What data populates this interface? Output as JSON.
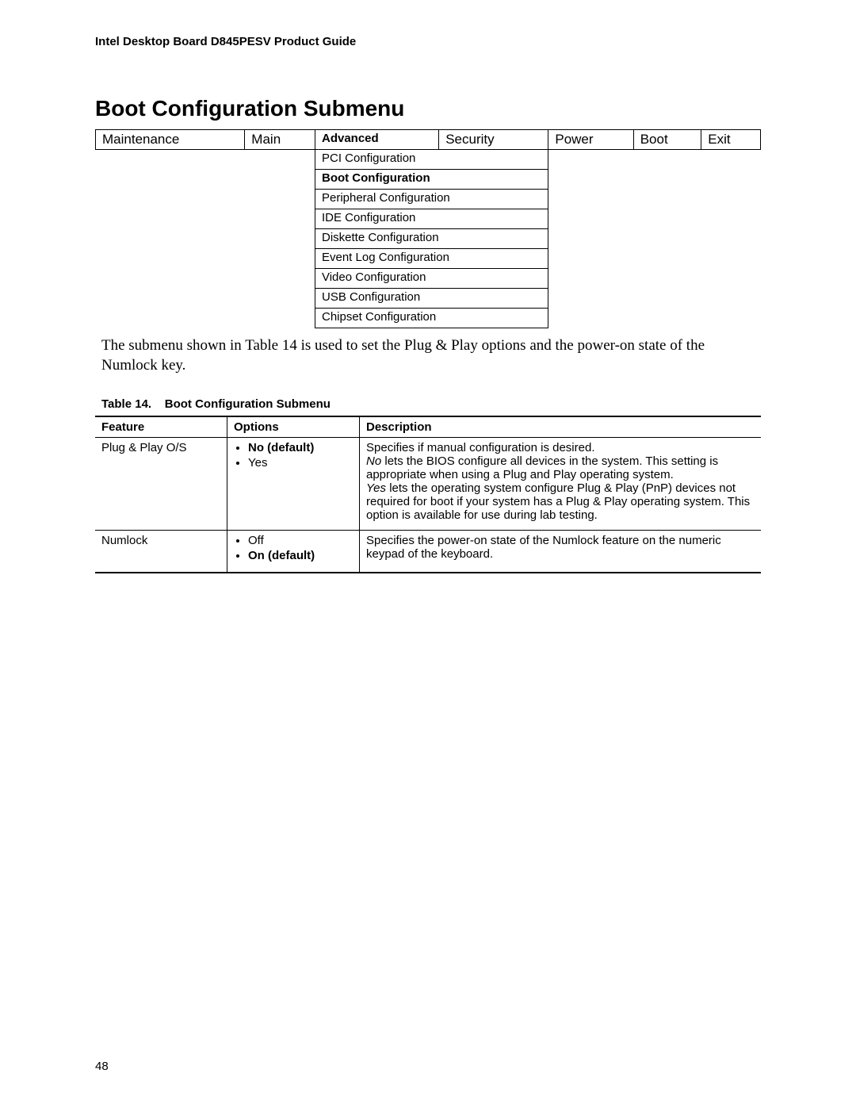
{
  "doc_header": "Intel Desktop Board D845PESV Product Guide",
  "section_title": "Boot Configuration Submenu",
  "nav": {
    "tabs": [
      "Maintenance",
      "Main",
      "Advanced",
      "Security",
      "Power",
      "Boot",
      "Exit"
    ],
    "active_index": 2,
    "submenu": [
      "PCI Configuration",
      "Boot Configuration",
      "Peripheral Configuration",
      "IDE Configuration",
      "Diskette Configuration",
      "Event Log Configuration",
      "Video Configuration",
      "USB Configuration",
      "Chipset Configuration"
    ],
    "submenu_active_index": 1
  },
  "body_text": "The submenu shown in Table 14 is used to set the Plug & Play options and the power-on state of the Numlock key.",
  "table_caption_prefix": "Table 14.",
  "table_caption_title": "Boot Configuration Submenu",
  "datatable": {
    "headers": {
      "feature": "Feature",
      "options": "Options",
      "description": "Description"
    },
    "rows": [
      {
        "feature": "Plug & Play O/S",
        "options": [
          {
            "label": "No (default)",
            "bold": true
          },
          {
            "label": "Yes",
            "bold": false
          }
        ],
        "description": {
          "line1": "Specifies if manual configuration is desired.",
          "no_prefix": "No",
          "no_rest": " lets the BIOS configure all devices in the system.  This setting is appropriate when using a Plug and Play operating system.",
          "yes_prefix": "Yes",
          "yes_rest": " lets the operating system configure Plug & Play (PnP) devices not required for boot if your system has a Plug & Play operating system.  This option is available for use during lab testing."
        }
      },
      {
        "feature": "Numlock",
        "options": [
          {
            "label": "Off",
            "bold": false
          },
          {
            "label": "On (default)",
            "bold": true
          }
        ],
        "description": {
          "line1": "Specifies the power-on state of the Numlock feature on the numeric keypad of the keyboard."
        }
      }
    ]
  },
  "page_number": "48"
}
